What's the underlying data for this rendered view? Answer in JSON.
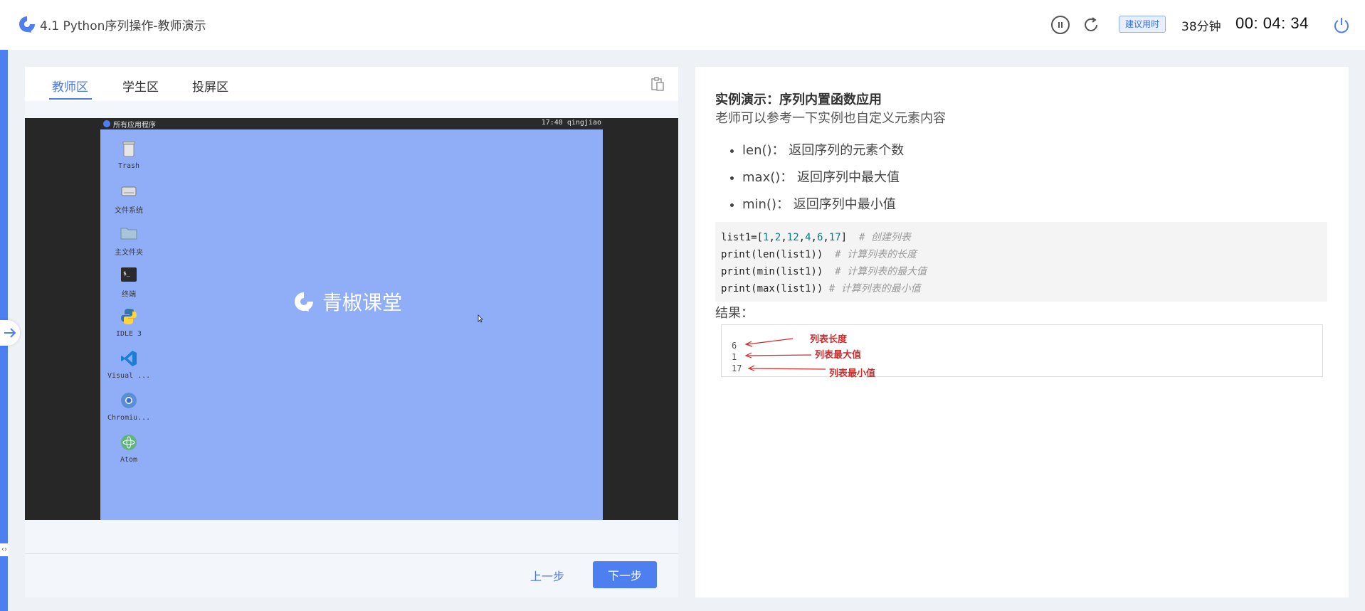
{
  "header": {
    "title": "4.1 Python序列操作-教师演示",
    "badge": "建议用时",
    "minutes": "38分钟",
    "timer": "00: 04: 34"
  },
  "tabs": [
    "教师区",
    "学生区",
    "投屏区"
  ],
  "desktop": {
    "menu_label": "所有应用程序",
    "clock": "17:40 qingjiao",
    "brand": "青椒课堂",
    "icons": [
      "Trash",
      "文件系统",
      "主文件夹",
      "终端",
      "IDLE 3",
      "Visual ...",
      "Chromiu...",
      "Atom"
    ]
  },
  "footer": {
    "prev": "上一步",
    "next": "下一步"
  },
  "content": {
    "title": "实例演示：序列内置函数应用",
    "subtitle": "老师可以参考一下实例也自定义元素内容",
    "bullets": [
      "len()： 返回序列的元素个数",
      "max()：  返回序列中最大值",
      "min()： 返回序列中最小值"
    ],
    "code": [
      "list1=[1,2,12,4,6,17]",
      "print(len(list1))",
      "print(min(list1))",
      "print(max(list1))"
    ],
    "comments": [
      "# 创建列表",
      "# 计算列表的长度",
      "# 计算列表的最大值",
      "# 计算列表的最小值"
    ],
    "result_label": "结果：",
    "result_values": [
      "6",
      "1",
      "17"
    ],
    "result_notes": [
      "列表长度",
      "列表最大值",
      "列表最小值"
    ]
  },
  "colors": {
    "accent": "#4e7ff0",
    "desktop_bg": "#90aef8",
    "annotation_red": "#d42a2a"
  }
}
